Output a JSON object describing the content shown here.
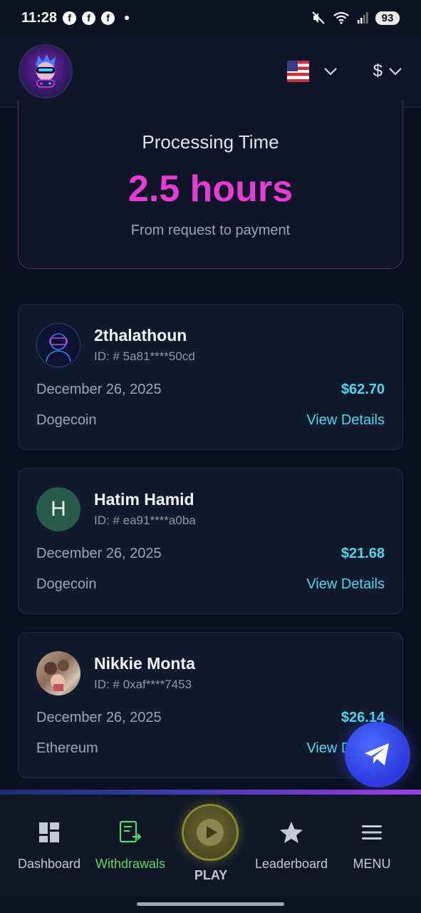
{
  "status_bar": {
    "time": "11:28",
    "battery": "93"
  },
  "header": {
    "currency_symbol": "$"
  },
  "processing": {
    "title": "Processing Time",
    "value": "2.5 hours",
    "subtitle": "From request to payment"
  },
  "withdrawals": [
    {
      "name": "2thalathoun",
      "id": "ID: # 5a81****50cd",
      "date": "December 26, 2025",
      "amount": "$62.70",
      "coin": "Dogecoin",
      "link": "View Details",
      "avatar_type": "vr-headset-icon"
    },
    {
      "name": "Hatim Hamid",
      "id": "ID: # ea91****a0ba",
      "date": "December 26, 2025",
      "amount": "$21.68",
      "coin": "Dogecoin",
      "link": "View Details",
      "avatar_letter": "H"
    },
    {
      "name": "Nikkie Monta",
      "id": "ID: # 0xaf****7453",
      "date": "December 26, 2025",
      "amount": "$26.14",
      "coin": "Ethereum",
      "link": "View Details",
      "avatar_type": "photo"
    }
  ],
  "nav": {
    "dashboard": "Dashboard",
    "withdrawals": "Withdrawals",
    "play": "PLAY",
    "leaderboard": "Leaderboard",
    "menu": "MENU"
  },
  "colors": {
    "accent_magenta": "#e73bd6",
    "accent_cyan": "#4fd8ee",
    "active_nav": "#5cd86a",
    "background": "#0a1020"
  }
}
